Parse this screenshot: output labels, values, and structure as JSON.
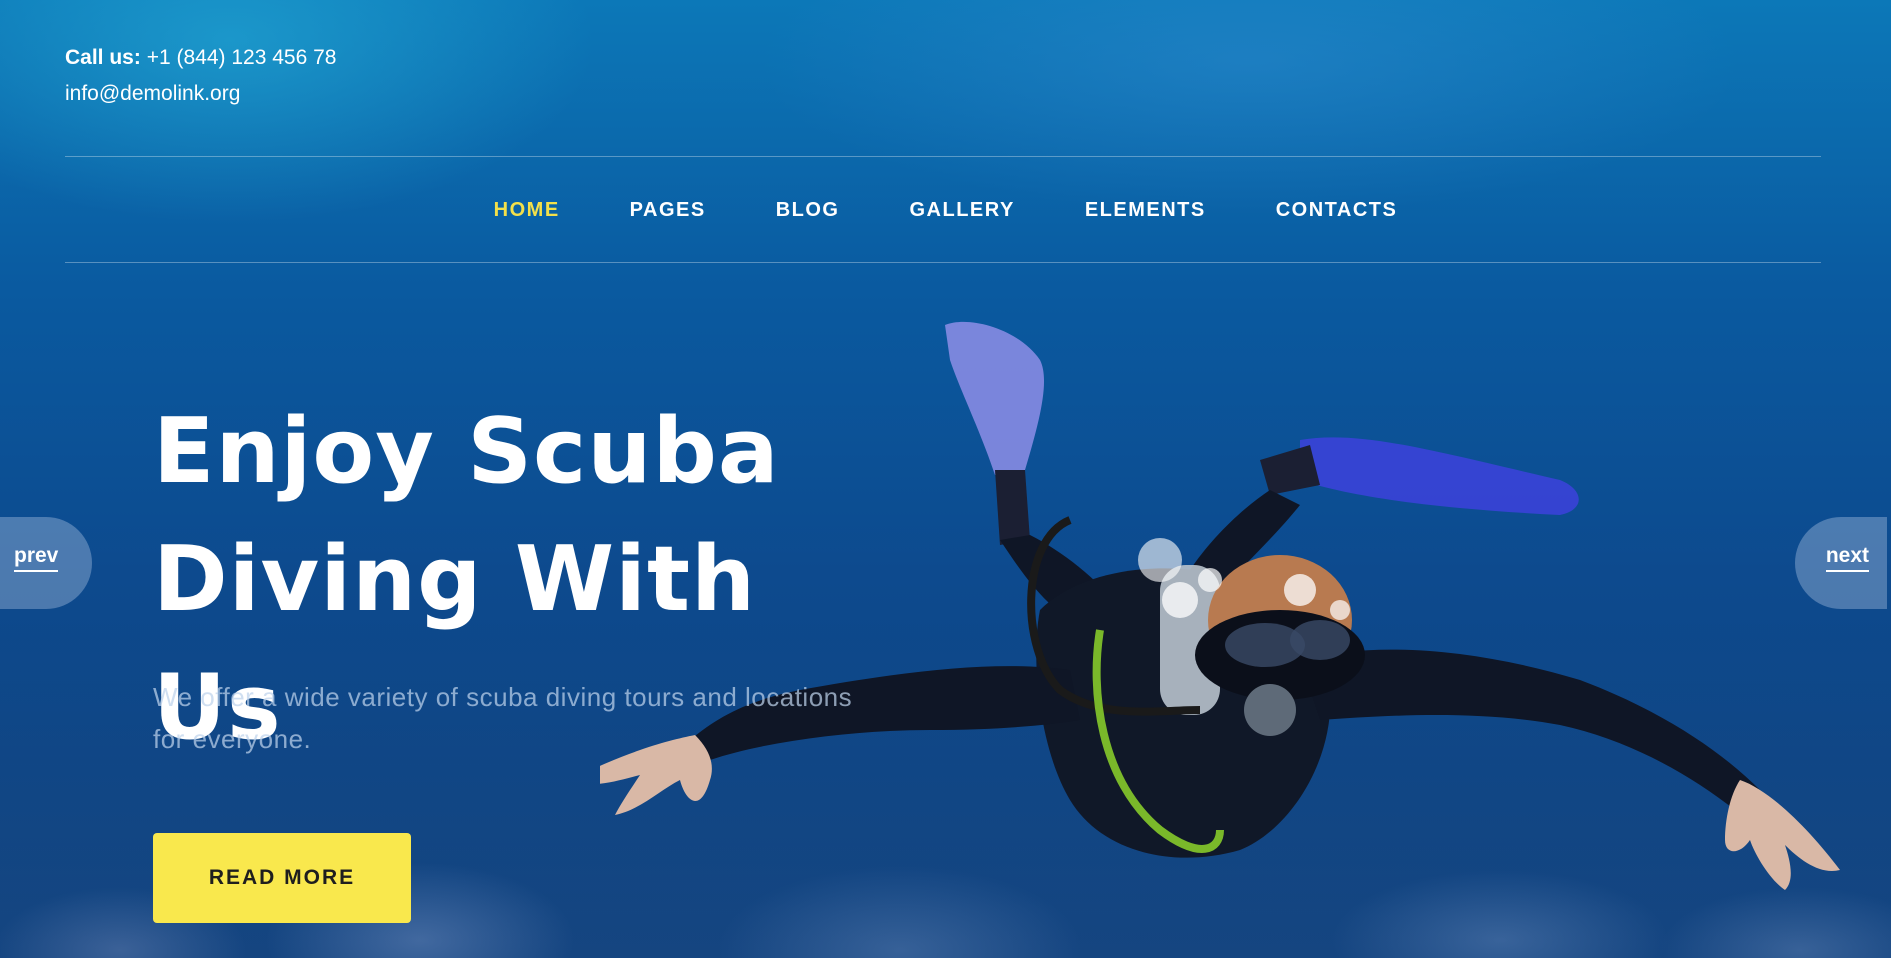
{
  "header": {
    "call_label": "Call us:",
    "phone": "+1 (844) 123 456 78",
    "email": "info@demolink.org"
  },
  "nav": {
    "items": [
      {
        "label": "HOME",
        "active": true
      },
      {
        "label": "PAGES",
        "active": false
      },
      {
        "label": "BLOG",
        "active": false
      },
      {
        "label": "GALLERY",
        "active": false
      },
      {
        "label": "ELEMENTS",
        "active": false
      },
      {
        "label": "CONTACTS",
        "active": false
      }
    ]
  },
  "hero": {
    "title_line1": "Enjoy Scuba",
    "title_line2": "Diving With Us",
    "subtitle": "We offer a wide variety of scuba diving tours and locations for everyone.",
    "cta_label": "READ MORE"
  },
  "slider": {
    "prev_label": "prev",
    "next_label": "next"
  },
  "colors": {
    "accent": "#f9e84d",
    "active_nav": "#f3e04a",
    "background_top": "#0c78b8",
    "background_bottom": "#0b3f7a"
  }
}
